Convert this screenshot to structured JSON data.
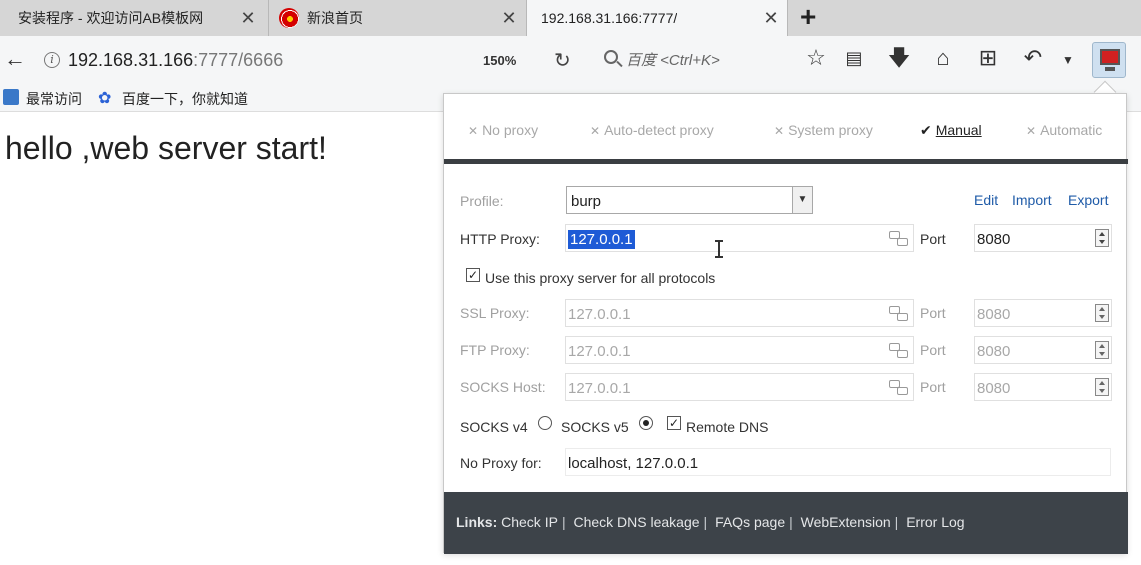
{
  "tabs": [
    {
      "title": "安装程序 - 欢迎访问AB模板网",
      "close": "✕"
    },
    {
      "title": "新浪首页",
      "close": "✕"
    },
    {
      "title": "192.168.31.166:7777/",
      "close": "✕"
    }
  ],
  "new_tab": "+",
  "nav": {
    "back": "←",
    "url_host": "192.168.31.166",
    "url_rest": ":7777/6666",
    "zoom": "150%",
    "reload": "C",
    "search_placeholder": "百度 <Ctrl+K>"
  },
  "toolbar_icons": [
    "star-icon",
    "reader-icon",
    "download-icon",
    "home-icon",
    "crop-icon",
    "undo-icon",
    "dropdown-icon",
    "proxy-monitor-icon"
  ],
  "bookmarks": [
    {
      "label": "最常访问"
    },
    {
      "label": "百度一下，你就知道"
    }
  ],
  "page": {
    "text": "hello ,web server start!"
  },
  "proxy_panel": {
    "modes": [
      {
        "label": "No proxy",
        "mark": "✕"
      },
      {
        "label": "Auto-detect proxy",
        "mark": "✕"
      },
      {
        "label": "System proxy",
        "mark": "✕"
      },
      {
        "label": "Manual",
        "mark": "✔"
      },
      {
        "label": "Automatic",
        "mark": "✕"
      }
    ],
    "active_mode": "Manual",
    "profile_label": "Profile:",
    "profile_value": "burp",
    "links": {
      "edit": "Edit",
      "import": "Import",
      "export": "Export"
    },
    "http": {
      "label": "HTTP Proxy:",
      "host": "127.0.0.1",
      "port_label": "Port",
      "port": "8080"
    },
    "use_for_all": {
      "label": "Use this proxy server for all protocols",
      "checked": true
    },
    "ssl": {
      "label": "SSL Proxy:",
      "host": "127.0.0.1",
      "port_label": "Port",
      "port": "8080"
    },
    "ftp": {
      "label": "FTP Proxy:",
      "host": "127.0.0.1",
      "port_label": "Port",
      "port": "8080"
    },
    "socks": {
      "label": "SOCKS Host:",
      "host": "127.0.0.1",
      "port_label": "Port",
      "port": "8080"
    },
    "socks_v4": {
      "label": "SOCKS v4",
      "selected": false
    },
    "socks_v5": {
      "label": "SOCKS v5",
      "selected": true
    },
    "remote_dns": {
      "label": "Remote DNS",
      "checked": true
    },
    "no_proxy": {
      "label": "No Proxy for:",
      "value": "localhost, 127.0.0.1"
    },
    "footer": {
      "links_label": "Links:",
      "items": [
        "Check IP",
        "Check DNS leakage",
        "FAQs page",
        "WebExtension",
        "Error Log"
      ],
      "separator": "|"
    }
  },
  "colors": {
    "panel_footer": "#3d4349",
    "selection": "#1e5bd6",
    "link": "#1f5ba8",
    "tab_strip": "#d6d6d6"
  }
}
